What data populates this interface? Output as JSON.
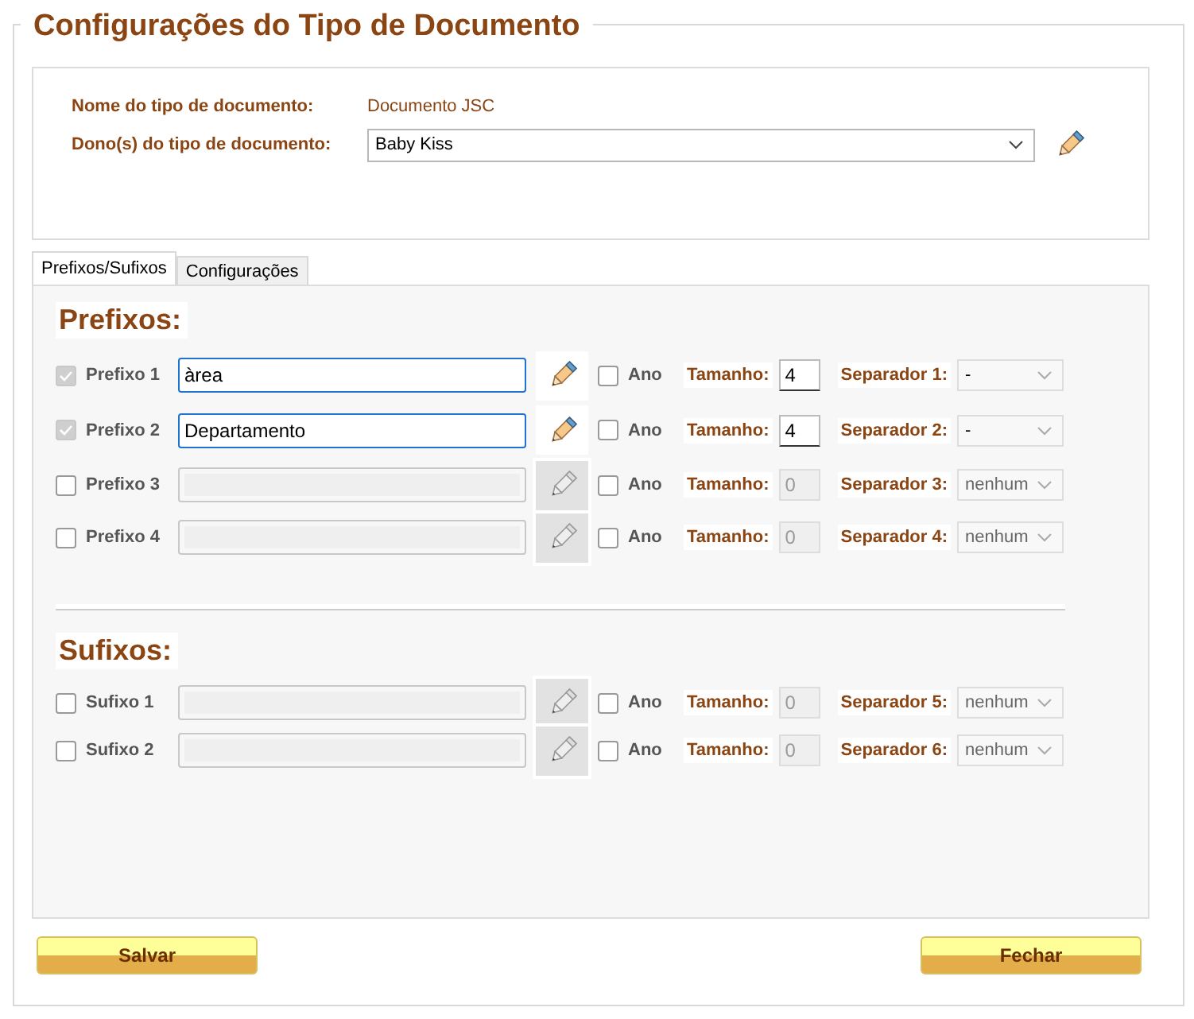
{
  "title": "Configurações do Tipo de Documento",
  "header": {
    "name_label": "Nome do tipo de documento:",
    "name_value": "Documento JSC",
    "owner_label": "Dono(s) do tipo de documento:",
    "owner_value": "Baby Kiss"
  },
  "tabs": [
    {
      "label": "Prefixos/Sufixos",
      "selected": true
    },
    {
      "label": "Configurações",
      "selected": false
    }
  ],
  "sections": [
    {
      "title": "Prefixos:",
      "rows": [
        {
          "checked": true,
          "label": "Prefixo 1",
          "value": "àrea",
          "disabled": false,
          "year_label": "Ano",
          "year_checked": false,
          "size_label": "Tamanho:",
          "size": "4",
          "separator_label": "Separador 1:",
          "separator": "-"
        },
        {
          "checked": true,
          "label": "Prefixo 2",
          "value": "Departamento",
          "disabled": false,
          "year_label": "Ano",
          "year_checked": false,
          "size_label": "Tamanho:",
          "size": "4",
          "separator_label": "Separador 2:",
          "separator": "-"
        },
        {
          "checked": false,
          "label": "Prefixo 3",
          "disabled": true,
          "year_label": "Ano",
          "year_checked": false,
          "size_label": "Tamanho:",
          "size": "0",
          "separator_label": "Separador 3:",
          "separator": "nenhum"
        },
        {
          "checked": false,
          "label": "Prefixo 4",
          "disabled": true,
          "year_label": "Ano",
          "year_checked": false,
          "size_label": "Tamanho:",
          "size": "0",
          "separator_label": "Separador 4:",
          "separator": "nenhum"
        }
      ]
    },
    {
      "title": "Sufixos:",
      "rows": [
        {
          "checked": false,
          "label": "Sufixo 1",
          "disabled": true,
          "year_label": "Ano",
          "year_checked": false,
          "size_label": "Tamanho:",
          "size": "0",
          "separator_label": "Separador 5:",
          "separator": "nenhum"
        },
        {
          "checked": false,
          "label": "Sufixo 2",
          "disabled": true,
          "year_label": "Ano",
          "year_checked": false,
          "size_label": "Tamanho:",
          "size": "0",
          "separator_label": "Separador 6:",
          "separator": "nenhum"
        }
      ]
    }
  ],
  "buttons": [
    "Salvar",
    "Fechar"
  ]
}
